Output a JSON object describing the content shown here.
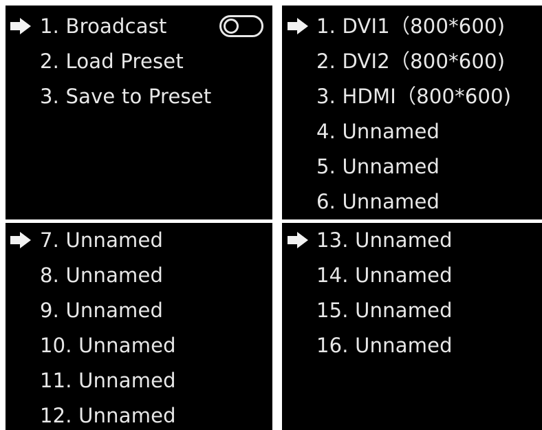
{
  "panels": {
    "main_menu": {
      "items": [
        {
          "label": "1. Broadcast"
        },
        {
          "label": "2. Load Preset"
        },
        {
          "label": "3. Save to Preset"
        }
      ],
      "broadcast_toggle": {
        "state": "off"
      }
    },
    "presets_a": {
      "items": [
        {
          "label": "1. DVI1（800*600)"
        },
        {
          "label": "2. DVI2（800*600)"
        },
        {
          "label": "3. HDMI（800*600)"
        },
        {
          "label": "4. Unnamed"
        },
        {
          "label": "5. Unnamed"
        },
        {
          "label": "6. Unnamed"
        }
      ]
    },
    "presets_b": {
      "items": [
        {
          "label": "7. Unnamed"
        },
        {
          "label": "8. Unnamed"
        },
        {
          "label": "9. Unnamed"
        },
        {
          "label": "10. Unnamed"
        },
        {
          "label": "11. Unnamed"
        },
        {
          "label": "12. Unnamed"
        }
      ]
    },
    "presets_c": {
      "items": [
        {
          "label": "13. Unnamed"
        },
        {
          "label": "14. Unnamed"
        },
        {
          "label": "15. Unnamed"
        },
        {
          "label": "16. Unnamed"
        }
      ]
    }
  },
  "icons": {
    "selector": "arrow-right-icon",
    "toggle": "toggle-switch-icon"
  },
  "colors": {
    "screen_background": "#000000",
    "text": "#e8e8e8",
    "divider": "#ffffff"
  }
}
